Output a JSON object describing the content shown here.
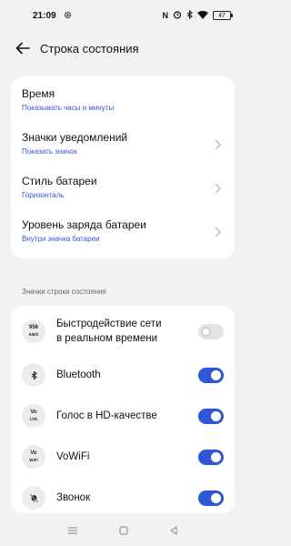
{
  "status_bar": {
    "time": "21:09",
    "icons": [
      "settings-gear-icon",
      "nfc-icon",
      "alarm-icon",
      "bluetooth-icon",
      "wifi-icon"
    ],
    "nfc_label": "N",
    "battery": "47"
  },
  "header": {
    "title": "Строка состояния"
  },
  "settings": [
    {
      "label": "Время",
      "sub": "Показывать часы и минуты",
      "chevron": false
    },
    {
      "label": "Значки уведомлений",
      "sub": "Показать значок",
      "chevron": true
    },
    {
      "label": "Стиль батареи",
      "sub": "Горизонталь",
      "chevron": true
    },
    {
      "label": "Уровень заряда батареи",
      "sub": "Внутри значка батареи",
      "chevron": true
    }
  ],
  "section_title": "Значки строки состояния",
  "toggles": [
    {
      "icon": "network-speed-icon",
      "icon_text_1": "956",
      "icon_text_2": "KB/S",
      "label_1": "Быстродействие сети",
      "label_2": "в реальном времени",
      "on": false
    },
    {
      "icon": "bluetooth-icon",
      "label_1": "Bluetooth",
      "on": true
    },
    {
      "icon": "volte-icon",
      "icon_text_1": "Vo",
      "icon_text_2": "LTE",
      "label_1": "Голос в HD-качестве",
      "on": true
    },
    {
      "icon": "vowifi-icon",
      "icon_text_1": "Vo",
      "icon_text_2": "WiFi",
      "label_1": "VoWiFi",
      "on": true
    },
    {
      "icon": "bell-muted-icon",
      "label_1": "Звонок",
      "on": true
    }
  ],
  "colors": {
    "accent": "#2f56d6",
    "background": "#f2f2f2",
    "card": "#ffffff"
  }
}
